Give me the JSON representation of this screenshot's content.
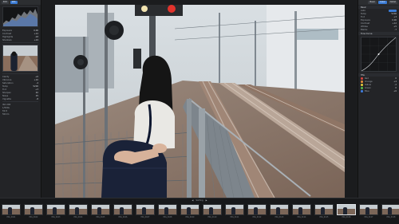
{
  "app": {
    "left_tabs": [
      "Edit",
      "Info"
    ],
    "right_tabs": [
      "Basic",
      "Color",
      "Detail"
    ]
  },
  "left_panel": {
    "rows_top": [
      {
        "label": "Exposure",
        "value": "0.00"
      },
      {
        "label": "Contrast",
        "value": "+12"
      },
      {
        "label": "Highlights",
        "value": "-18"
      },
      {
        "label": "Shadows",
        "value": "+24"
      }
    ],
    "rows_bottom": [
      {
        "label": "Clarity",
        "value": "+6"
      },
      {
        "label": "Vibrance",
        "value": "+10"
      },
      {
        "label": "Saturation",
        "value": "-4"
      },
      {
        "label": "Temp",
        "value": "5200"
      },
      {
        "label": "Tint",
        "value": "+3"
      },
      {
        "label": "Sharpen",
        "value": "40"
      },
      {
        "label": "Noise",
        "value": "25"
      },
      {
        "label": "Vignette",
        "value": "-8"
      }
    ],
    "info_lines": [
      "ISO 200",
      "1/500s",
      "f/2.8",
      "50mm"
    ]
  },
  "right_panel": {
    "section_basic": "Basic",
    "section_curve": "Tone Curve",
    "section_hsl": "HSL",
    "rows": [
      {
        "label": "Auto",
        "value": ""
      },
      {
        "label": "Temp",
        "value": "5200"
      },
      {
        "label": "Tint",
        "value": "+3"
      },
      {
        "label": "Exposure",
        "value": "0.00"
      },
      {
        "label": "Contrast",
        "value": "+12"
      },
      {
        "label": "Whites",
        "value": "+5"
      },
      {
        "label": "Blacks",
        "value": "-7"
      }
    ],
    "hsl_rows": [
      {
        "label": "Red",
        "value": "0",
        "color": "#d0433c"
      },
      {
        "label": "Orange",
        "value": "+4",
        "color": "#e08a3a"
      },
      {
        "label": "Yellow",
        "value": "-2",
        "color": "#d9c23a"
      },
      {
        "label": "Green",
        "value": "0",
        "color": "#4fae4a"
      },
      {
        "label": "Blue",
        "value": "+6",
        "color": "#3f7bd6"
      }
    ]
  },
  "filmstrip": {
    "header": [
      "◀",
      "Sorting",
      "▶"
    ],
    "items": [
      {
        "caption": "IMG_0101",
        "selected": false
      },
      {
        "caption": "IMG_0102",
        "selected": false
      },
      {
        "caption": "IMG_0103",
        "selected": false
      },
      {
        "caption": "IMG_0104",
        "selected": false
      },
      {
        "caption": "IMG_0105",
        "selected": false
      },
      {
        "caption": "IMG_0106",
        "selected": false
      },
      {
        "caption": "IMG_0107",
        "selected": false
      },
      {
        "caption": "IMG_0108",
        "selected": false
      },
      {
        "caption": "IMG_0109",
        "selected": false
      },
      {
        "caption": "IMG_0110",
        "selected": false
      },
      {
        "caption": "IMG_0111",
        "selected": false
      },
      {
        "caption": "IMG_0112",
        "selected": false
      },
      {
        "caption": "IMG_0113",
        "selected": false
      },
      {
        "caption": "IMG_0114",
        "selected": false
      },
      {
        "caption": "IMG_0115",
        "selected": false
      },
      {
        "caption": "IMG_0116",
        "selected": true
      },
      {
        "caption": "IMG_0117",
        "selected": false
      },
      {
        "caption": "IMG_0118",
        "selected": false
      }
    ]
  },
  "colors": {
    "accent": "#3a7bd5",
    "panel": "#232427",
    "background": "#1b1c1e"
  }
}
